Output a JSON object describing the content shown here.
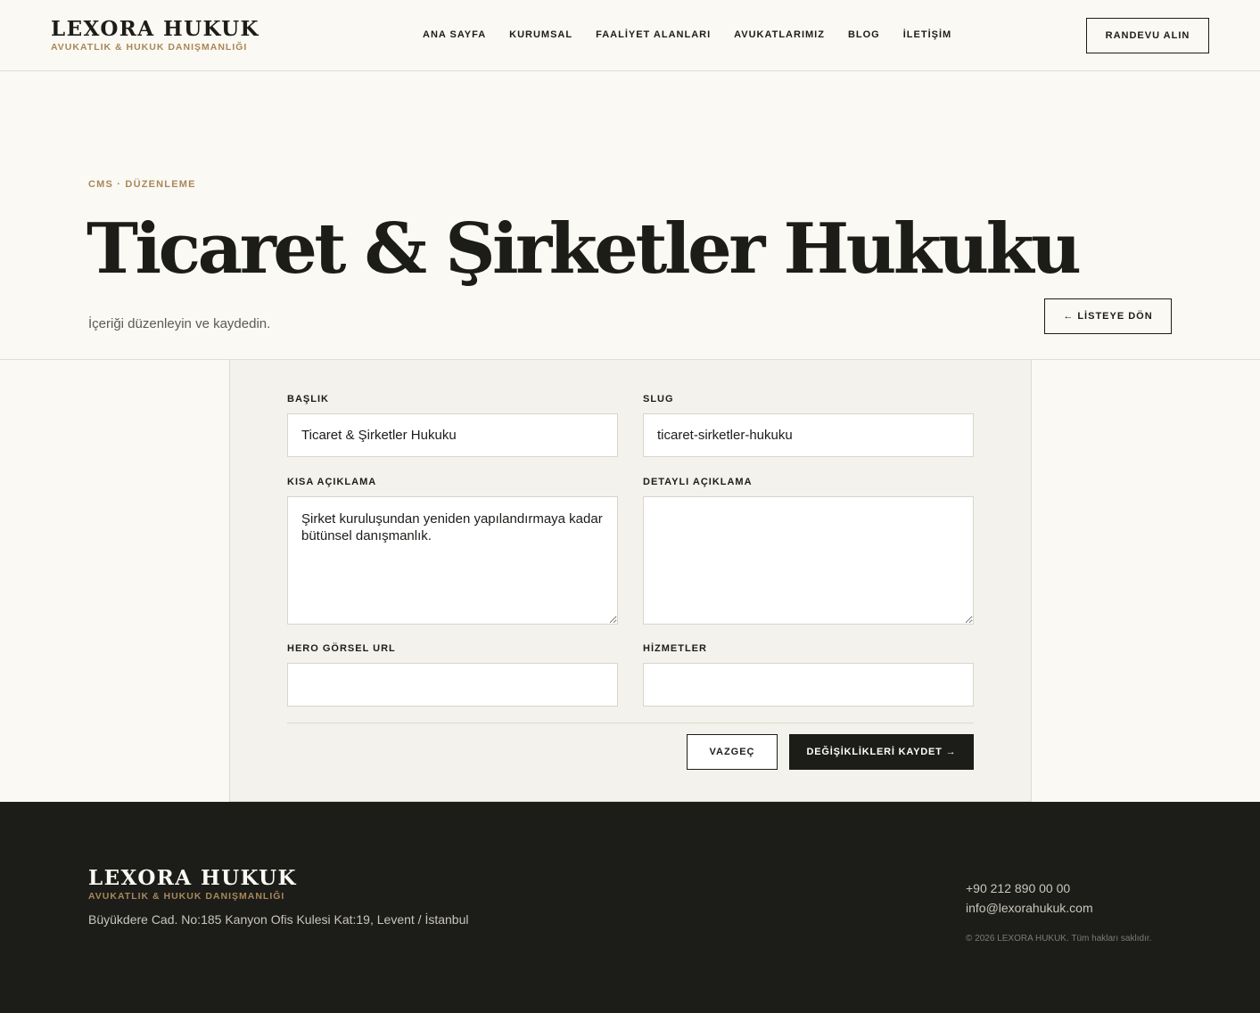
{
  "brand": {
    "name": "LEXORA HUKUK",
    "tagline": "AVUKATLIK & HUKUK DANIŞMANLIĞI"
  },
  "nav": {
    "items": [
      {
        "label": "ANA SAYFA"
      },
      {
        "label": "KURUMSAL"
      },
      {
        "label": "FAALİYET ALANLARI"
      },
      {
        "label": "AVUKATLARIMIZ"
      },
      {
        "label": "BLOG"
      },
      {
        "label": "İLETİŞİM"
      }
    ],
    "cta_label": "RANDEVU ALIN"
  },
  "hero": {
    "eyebrow": "CMS · DÜZENLEME",
    "title": "Ticaret & Şirketler Hukuku",
    "subtitle": "İçeriği düzenleyin ve kaydedin.",
    "back_label": "LİSTEYE DÖN",
    "back_arrow": "←"
  },
  "form": {
    "title": {
      "label": "BAŞLIK",
      "value": "Ticaret & Şirketler Hukuku"
    },
    "slug": {
      "label": "SLUG",
      "value": "ticaret-sirketler-hukuku"
    },
    "short_description": {
      "label": "KISA AÇIKLAMA",
      "value": "Şirket kuruluşundan yeniden yapılandırmaya kadar bütünsel danışmanlık."
    },
    "detailed_description": {
      "label": "DETAYLI AÇIKLAMA",
      "value": ""
    },
    "hero_image_url": {
      "label": "HERO GÖRSEL URL",
      "value": ""
    },
    "services": {
      "label": "HİZMETLER",
      "value": ""
    },
    "cancel_label": "VAZGEÇ",
    "save_label": "DEĞİŞİKLİKLERİ KAYDET",
    "save_arrow": "→"
  },
  "footer": {
    "brand_name": "LEXORA HUKUK",
    "brand_tagline": "AVUKATLIK & HUKUK DANIŞMANLIĞI",
    "address": "Büyükdere Cad. No:185 Kanyon Ofis Kulesi Kat:19, Levent / İstanbul",
    "phone": "+90 212 890 00 00",
    "email": "info@lexorahukuk.com",
    "copyright": "© 2026 LEXORA HUKUK. Tüm hakları saklıdır."
  },
  "colors": {
    "background": "#fbf9f3",
    "ink": "#1c1c19",
    "accent_gold": "#a9875a",
    "card": "#f4f2ec"
  }
}
